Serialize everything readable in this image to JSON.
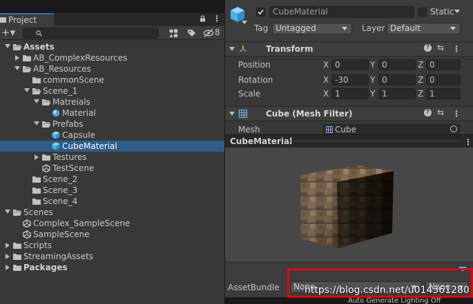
{
  "project": {
    "tab_label": "Project",
    "hidden_count": "8",
    "tree": [
      {
        "label": "Assets",
        "indent": 0,
        "expanded": true,
        "icon": "folder-open",
        "bold": true
      },
      {
        "label": "AB_ComplexResources",
        "indent": 1,
        "expanded": false,
        "icon": "folder"
      },
      {
        "label": "AB_Resources",
        "indent": 1,
        "expanded": true,
        "icon": "folder-open"
      },
      {
        "label": "commonScene",
        "indent": 2,
        "expanded": null,
        "icon": "folder"
      },
      {
        "label": "Scene_1",
        "indent": 2,
        "expanded": true,
        "icon": "folder-open"
      },
      {
        "label": "Matreials",
        "indent": 3,
        "expanded": true,
        "icon": "folder-open"
      },
      {
        "label": "Material",
        "indent": 4,
        "expanded": null,
        "icon": "material"
      },
      {
        "label": "Prefabs",
        "indent": 3,
        "expanded": true,
        "icon": "folder-open"
      },
      {
        "label": "Capsule",
        "indent": 4,
        "expanded": null,
        "icon": "prefab"
      },
      {
        "label": "CubeMaterial",
        "indent": 4,
        "expanded": null,
        "icon": "prefab",
        "selected": true
      },
      {
        "label": "Testures",
        "indent": 3,
        "expanded": false,
        "icon": "folder"
      },
      {
        "label": "TestScene",
        "indent": 3,
        "expanded": null,
        "icon": "unity"
      },
      {
        "label": "Scene_2",
        "indent": 2,
        "expanded": null,
        "icon": "folder"
      },
      {
        "label": "Scene_3",
        "indent": 2,
        "expanded": null,
        "icon": "folder"
      },
      {
        "label": "Scene_4",
        "indent": 2,
        "expanded": null,
        "icon": "folder"
      },
      {
        "label": "Scenes",
        "indent": 0,
        "expanded": true,
        "icon": "folder-open"
      },
      {
        "label": "Complex_SampleScene",
        "indent": 1,
        "expanded": null,
        "icon": "unity"
      },
      {
        "label": "SampleScene",
        "indent": 1,
        "expanded": null,
        "icon": "unity"
      },
      {
        "label": "Scripts",
        "indent": 0,
        "expanded": false,
        "icon": "folder"
      },
      {
        "label": "StreamingAssets",
        "indent": 0,
        "expanded": false,
        "icon": "folder"
      },
      {
        "label": "Packages",
        "indent": -1,
        "expanded": false,
        "icon": "folder",
        "bold": true
      }
    ]
  },
  "inspector": {
    "object_name": "CubeMaterial",
    "static_label": "Static",
    "tag_label": "Tag",
    "tag_value": "Untagged",
    "layer_label": "Layer",
    "layer_value": "Default",
    "transform": {
      "title": "Transform",
      "rows": [
        {
          "label": "Position",
          "x": "0",
          "y": "0",
          "z": "0"
        },
        {
          "label": "Rotation",
          "x": "-30",
          "y": "0",
          "z": "0"
        },
        {
          "label": "Scale",
          "x": "1",
          "y": "1",
          "z": "1"
        }
      ],
      "axis_x": "X",
      "axis_y": "Y",
      "axis_z": "Z"
    },
    "mesh_filter": {
      "title": "Cube (Mesh Filter)",
      "mesh_label": "Mesh",
      "mesh_value": "Cube"
    },
    "preview_title": "CubeMaterial",
    "asset_bundle_label": "AssetBundle",
    "asset_bundle_value": "None",
    "asset_bundle_variant": "None",
    "auto_generate_lighting": "Auto Generate Lighting Off"
  },
  "watermark": "https://blog.csdn.net/u014361280",
  "colors": {
    "selection": "#2c5d87",
    "highlight_box": "#e60012",
    "accent": "#3a72b0"
  }
}
